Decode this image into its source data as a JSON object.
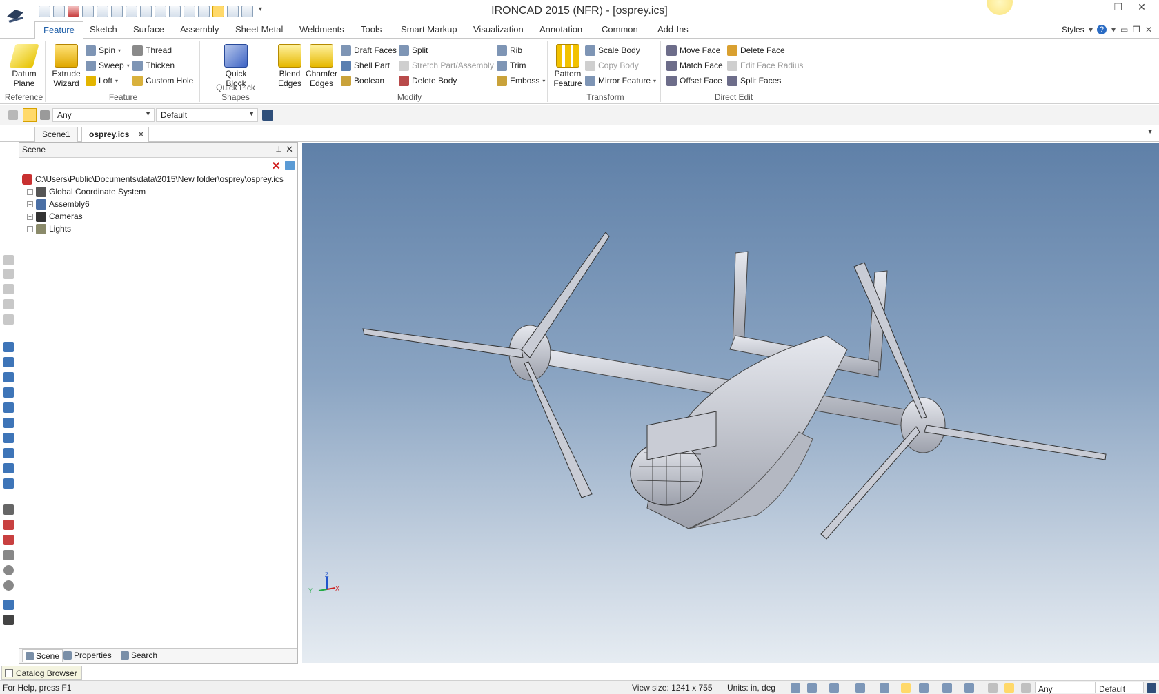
{
  "window": {
    "title": "IRONCAD 2015 (NFR) - [osprey.ics]",
    "minimize_glyph": "–",
    "restore_glyph": "❐",
    "close_glyph": "✕"
  },
  "ribbon_tabs": [
    "Feature",
    "Sketch",
    "Surface",
    "Assembly",
    "Sheet Metal",
    "Weldments",
    "Tools",
    "Smart Markup",
    "Visualization",
    "Annotation",
    "Common",
    "Add-Ins"
  ],
  "ribbon_right": {
    "styles": "Styles"
  },
  "groups": {
    "reference": {
      "label": "Reference",
      "datum_plane": "Datum Plane"
    },
    "feature": {
      "label": "Feature",
      "extrude_wizard": "Extrude Wizard",
      "spin": "Spin",
      "sweep": "Sweep",
      "loft": "Loft",
      "thread": "Thread",
      "thicken": "Thicken",
      "custom_hole": "Custom Hole"
    },
    "quick_pick": {
      "label": "Quick Pick Shapes",
      "quick_block": "Quick Block"
    },
    "modify": {
      "label": "Modify",
      "blend_edges": "Blend Edges",
      "chamfer_edges": "Chamfer Edges",
      "draft_faces": "Draft Faces",
      "shell_part": "Shell Part",
      "boolean": "Boolean",
      "split": "Split",
      "stretch": "Stretch Part/Assembly",
      "delete_body": "Delete Body",
      "rib": "Rib",
      "trim": "Trim",
      "emboss": "Emboss"
    },
    "transform": {
      "label": "Transform",
      "pattern_feature": "Pattern Feature",
      "scale_body": "Scale Body",
      "copy_body": "Copy Body",
      "mirror_feature": "Mirror Feature"
    },
    "direct_edit": {
      "label": "Direct Edit",
      "move_face": "Move Face",
      "match_face": "Match Face",
      "offset_face": "Offset Face",
      "delete_face": "Delete Face",
      "edit_face_radius": "Edit Face Radius",
      "split_faces": "Split Faces"
    }
  },
  "selection": {
    "filter": "Any",
    "style": "Default"
  },
  "doc_tabs": [
    "Scene1",
    "osprey.ics"
  ],
  "scene_panel": {
    "title": "Scene",
    "root": "C:\\Users\\Public\\Documents\\data\\2015\\New folder\\osprey\\osprey.ics",
    "items": [
      "Global Coordinate System",
      "Assembly6",
      "Cameras",
      "Lights"
    ],
    "footer_tabs": [
      "Scene",
      "Properties",
      "Search"
    ]
  },
  "catalog_browser": "Catalog Browser",
  "triad": {
    "x": "X",
    "y": "Y",
    "z": "Z"
  },
  "status": {
    "help": "For Help, press F1",
    "view_size": "View size: 1241 x 755",
    "units": "Units: in, deg",
    "filter": "Any",
    "style": "Default"
  },
  "colors": {
    "accent": "#1f5fa8",
    "viewport_top": "#5f80a8",
    "viewport_bottom": "#e6ecf2",
    "model": "#b9bcc6"
  }
}
